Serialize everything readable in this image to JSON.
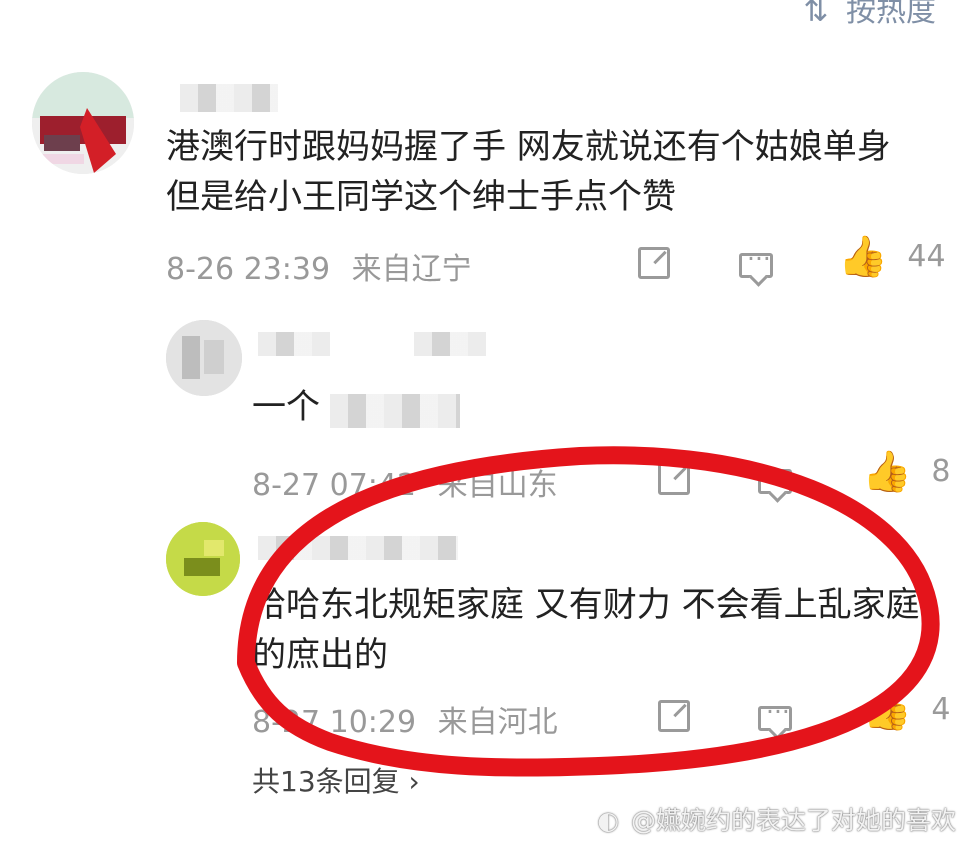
{
  "sort": {
    "label": "按热度",
    "icon": "sort-icon"
  },
  "comments": [
    {
      "name": "",
      "text_line1": "港澳行时跟妈妈握了手 网友就说还有个姑娘单身",
      "text_line2": "但是给小王同学这个绅士手点个赞",
      "date": "8-26 23:39",
      "location": "来自辽宁",
      "likes": "44"
    },
    {
      "name": "",
      "text": "一个",
      "date": "8-27 07:42",
      "location": "来自山东",
      "likes": "8"
    },
    {
      "name": "",
      "text_line1": "哈哈东北规矩家庭 又有财力 不会看上乱家庭",
      "text_line2": "的庶出的",
      "date": "8-27 10:29",
      "location": "来自河北",
      "likes": "4"
    }
  ],
  "thread": {
    "label": "共13条回复"
  },
  "watermark": {
    "text": "@嬿婉约的表达了对她的喜欢"
  },
  "colors": {
    "highlight": "#e4141b",
    "meta": "#999999",
    "action": "#9a9a9a"
  }
}
